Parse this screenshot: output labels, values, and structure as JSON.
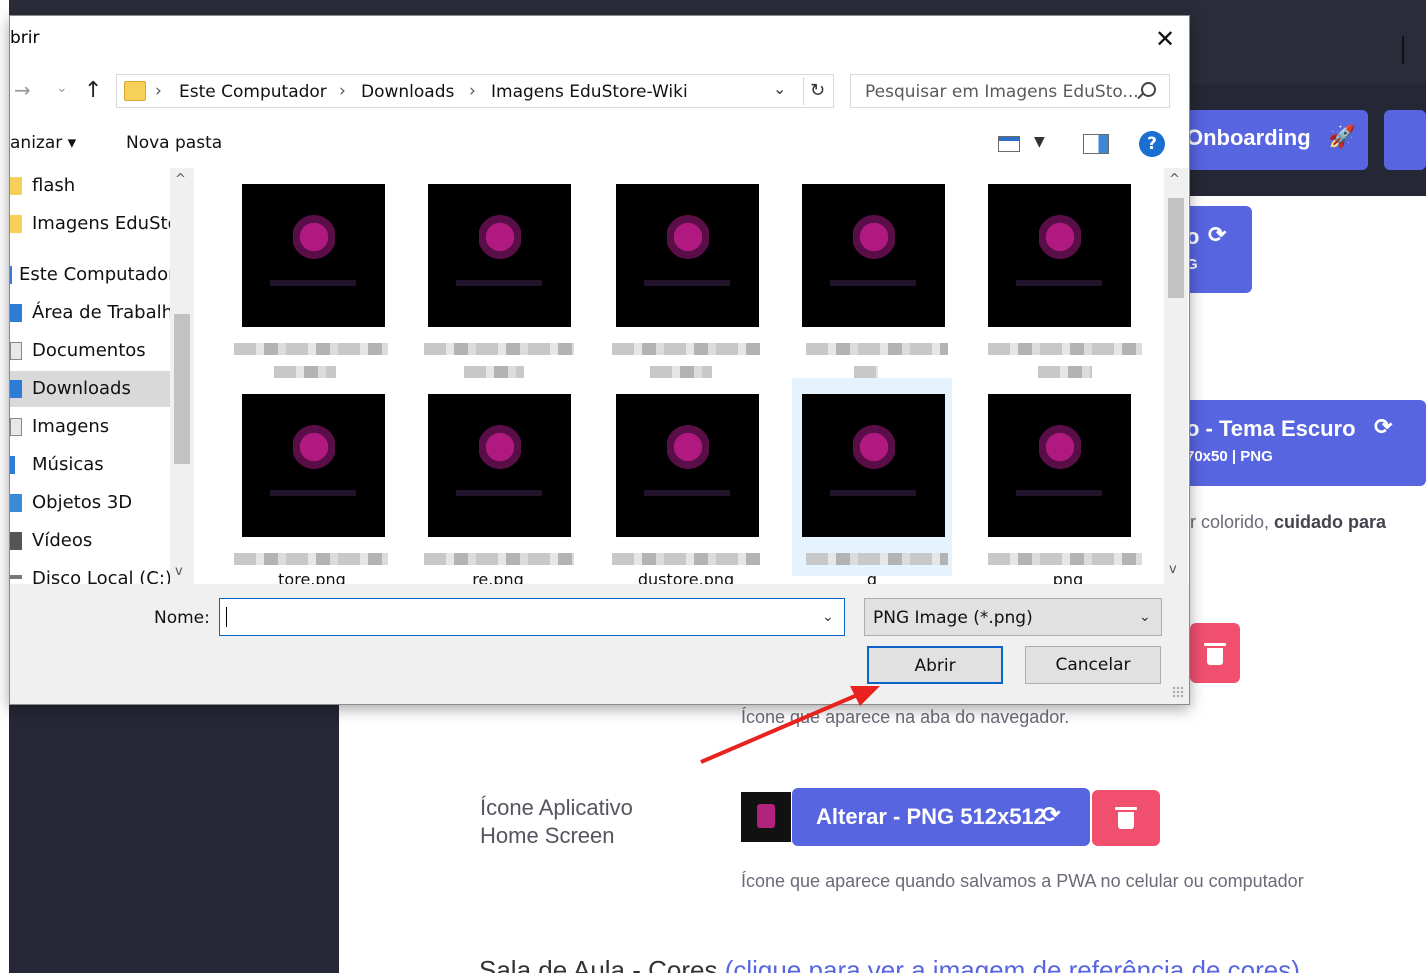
{
  "app": {
    "onboarding_label": "Onboarding",
    "btn1_title": "o",
    "btn1_sub": "G",
    "btn2_title": "o - Tema Escuro",
    "btn2_sub": "70x50 | PNG",
    "colorido_text_prefix": "r colorido, ",
    "colorido_text_bold": "cuidado para",
    "favicon_desc": "Ícone que aparece na aba do navegador.",
    "app_icon_label_line1": "Ícone Aplicativo",
    "app_icon_label_line2": "Home Screen",
    "alterar_512_label": "Alterar - PNG 512x512",
    "app_icon_desc": "Ícone que aparece quando salvamos a PWA no celular ou computador",
    "bottom_heading_prefix": "Sala de Aula - Cores",
    "bottom_heading_link": "(clique para ver a imagem de referência de cores)",
    "colors": {
      "accent": "#5865e0",
      "danger": "#f0506e",
      "dark_bg": "#262736"
    }
  },
  "dialog": {
    "title": "brir",
    "close_icon": "close-icon",
    "breadcrumb": [
      "Este Computador",
      "Downloads",
      "Imagens EduStore-Wiki"
    ],
    "search_placeholder": "Pesquisar em Imagens EduSto...",
    "toolbar": {
      "organize_label": "anizar ▾",
      "new_folder_label": "Nova pasta"
    },
    "nav_items": [
      {
        "label": "flash",
        "icon": "folder-icon"
      },
      {
        "label": "Imagens EduSto",
        "icon": "folder-icon"
      },
      {
        "label": "Este Computador",
        "icon": "computer-icon"
      },
      {
        "label": "Área de Trabalho",
        "icon": "desktop-icon"
      },
      {
        "label": "Documentos",
        "icon": "documents-icon"
      },
      {
        "label": "Downloads",
        "icon": "downloads-icon",
        "selected": true
      },
      {
        "label": "Imagens",
        "icon": "pictures-icon"
      },
      {
        "label": "Músicas",
        "icon": "music-icon"
      },
      {
        "label": "Objetos 3D",
        "icon": "objects-3d-icon"
      },
      {
        "label": "Vídeos",
        "icon": "videos-icon"
      },
      {
        "label": "Disco Local (C:)",
        "icon": "drive-icon"
      }
    ],
    "files": [
      {
        "caption": ""
      },
      {
        "caption": ""
      },
      {
        "caption": ""
      },
      {
        "caption": ""
      },
      {
        "caption": ""
      },
      {
        "caption": "tore.png"
      },
      {
        "caption": "re.png"
      },
      {
        "caption": "dustore.png"
      },
      {
        "caption": "g",
        "selected": true
      },
      {
        "caption": "png"
      }
    ],
    "name_label": "Nome:",
    "name_value": "",
    "file_type": "PNG Image (*.png)",
    "open_button": "Abrir",
    "cancel_button": "Cancelar"
  }
}
